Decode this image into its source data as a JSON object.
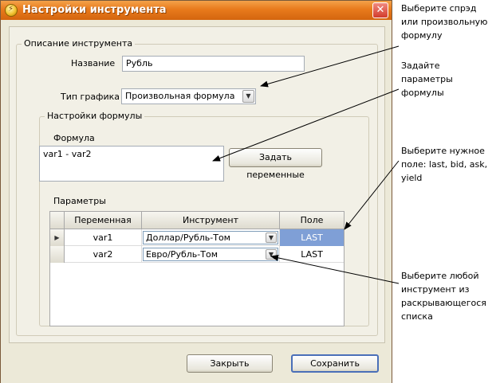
{
  "window": {
    "title": "Настройки инструмента",
    "close_glyph": "✕"
  },
  "instrument": {
    "group_label": "Описание инструмента",
    "name_label": "Название",
    "name_value": "Рубль",
    "chart_type_label": "Тип графика",
    "chart_type_value": "Произвольная формула"
  },
  "formula_settings": {
    "group_label": "Настройки формулы",
    "formula_label": "Формула",
    "formula_value": "var1 - var2",
    "set_vars_button": "Задать переменные",
    "params_label": "Параметры"
  },
  "grid": {
    "columns": [
      "Переменная",
      "Инструмент",
      "Поле"
    ],
    "rows": [
      {
        "variable": "var1",
        "instrument": "Доллар/Рубль-Том",
        "field": "LAST",
        "current": true
      },
      {
        "variable": "var2",
        "instrument": "Евро/Рубль-Том",
        "field": "LAST",
        "current": false
      }
    ],
    "row_indicator_glyph": "▶",
    "dropdown_glyph": "▼",
    "selected_color": "#7f9fd6"
  },
  "buttons": {
    "close": "Закрыть",
    "save": "Сохранить"
  },
  "annotations": {
    "note1": [
      "Выберите спрэд",
      "или произвольную",
      "формулу"
    ],
    "note2": [
      "Задайте",
      "параметры",
      "формулы"
    ],
    "note3": [
      "Выберите нужное",
      "поле: last, bid, ask,",
      "yield"
    ],
    "note4": [
      "Выберите любой",
      "инструмент из",
      "раскрывающегося",
      "списка"
    ]
  },
  "colors": {
    "titlebar": "#e87a1c",
    "dialog_bg": "#ece9d8",
    "default_button_border": "#4a6fb8"
  }
}
